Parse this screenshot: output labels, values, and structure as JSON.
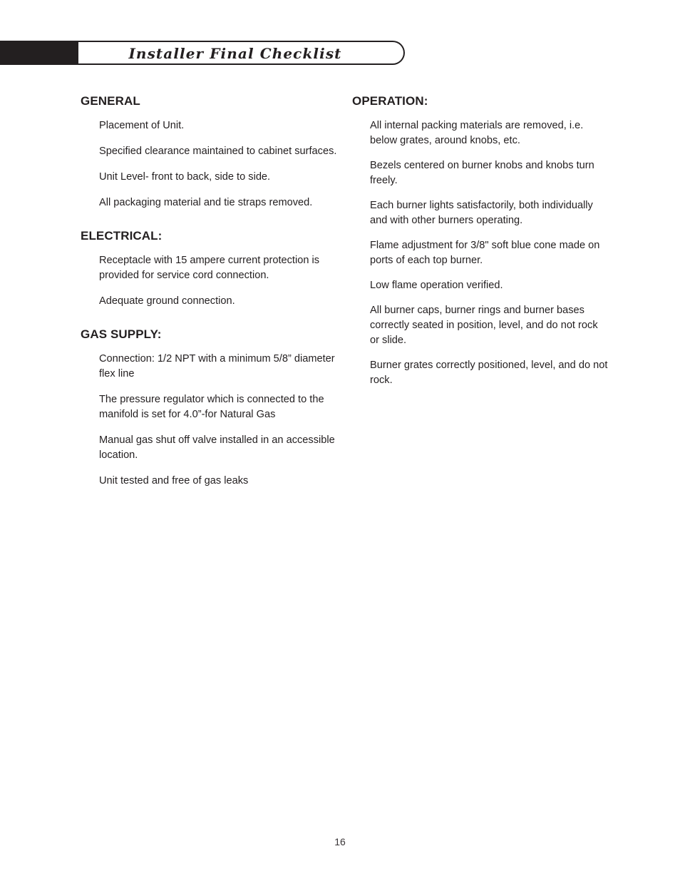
{
  "header": {
    "title": "Installer Final Checklist",
    "bar_color": "#231f20",
    "pill_border_color": "#231f20"
  },
  "left_column": {
    "sections": [
      {
        "heading": "GENERAL",
        "items": [
          "Placement of Unit.",
          "Specified clearance maintained to cabinet surfaces.",
          "Unit Level- front to back, side to side.",
          "All packaging material and tie straps removed."
        ]
      },
      {
        "heading": "ELECTRICAL:",
        "items": [
          "Receptacle with 15 ampere current protection is provided for service cord connection.",
          "Adequate ground connection."
        ]
      },
      {
        "heading": "GAS SUPPLY:",
        "items": [
          "Connection: 1/2 NPT with a minimum 5/8” diameter flex line",
          "The pressure regulator which is connected to the manifold is set for 4.0”-for Natural Gas",
          "Manual gas shut off valve installed in an accessible location.",
          "Unit tested and free of gas leaks"
        ]
      }
    ]
  },
  "right_column": {
    "sections": [
      {
        "heading": "OPERATION:",
        "items": [
          "All internal packing materials are removed, i.e. below grates, around knobs, etc.",
          "Bezels centered on burner knobs and knobs turn freely.",
          "Each burner lights satisfactorily, both individually and with other burners operating.",
          "Flame adjustment for 3/8\" soft blue cone made on ports of each top burner.",
          "Low flame operation verified.",
          "All burner caps, burner rings and burner bases correctly seated in position, level, and do not rock or slide.",
          "Burner grates correctly positioned, level, and do not rock."
        ]
      }
    ]
  },
  "footer": {
    "page_number": "16"
  }
}
